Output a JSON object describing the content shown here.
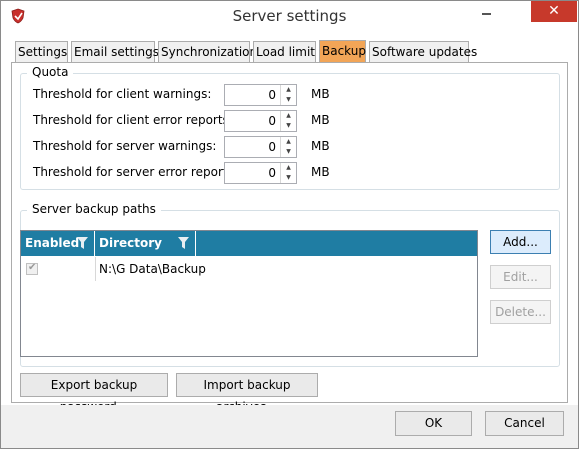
{
  "window": {
    "title": "Server settings",
    "close_glyph": "✕"
  },
  "tabs": [
    {
      "label": "Settings"
    },
    {
      "label": "Email settings"
    },
    {
      "label": "Synchronization"
    },
    {
      "label": "Load limit"
    },
    {
      "label": "Backup",
      "active": true
    },
    {
      "label": "Software updates"
    }
  ],
  "quota": {
    "title": "Quota",
    "rows": [
      {
        "label": "Threshold for client warnings:",
        "value": "0",
        "unit": "MB"
      },
      {
        "label": "Threshold for client error reports:",
        "value": "0",
        "unit": "MB"
      },
      {
        "label": "Threshold for server warnings:",
        "value": "0",
        "unit": "MB"
      },
      {
        "label": "Threshold for server error reports:",
        "value": "0",
        "unit": "MB"
      }
    ]
  },
  "backup_paths": {
    "title": "Server backup paths",
    "columns": {
      "enabled": "Enabled",
      "directory": "Directory"
    },
    "rows": [
      {
        "enabled": true,
        "directory": "N:\\G Data\\Backup"
      }
    ],
    "buttons": {
      "add": "Add...",
      "edit": "Edit...",
      "delete": "Delete..."
    }
  },
  "actions": {
    "export": "Export backup password...",
    "import": "Import backup archives..."
  },
  "footer": {
    "ok": "OK",
    "cancel": "Cancel"
  },
  "colors": {
    "accent_tab": "#f2a557",
    "grid_header": "#1f7da3",
    "close_button": "#c7392b"
  },
  "icons": {
    "app": "shield-icon",
    "filter": "filter-icon"
  }
}
